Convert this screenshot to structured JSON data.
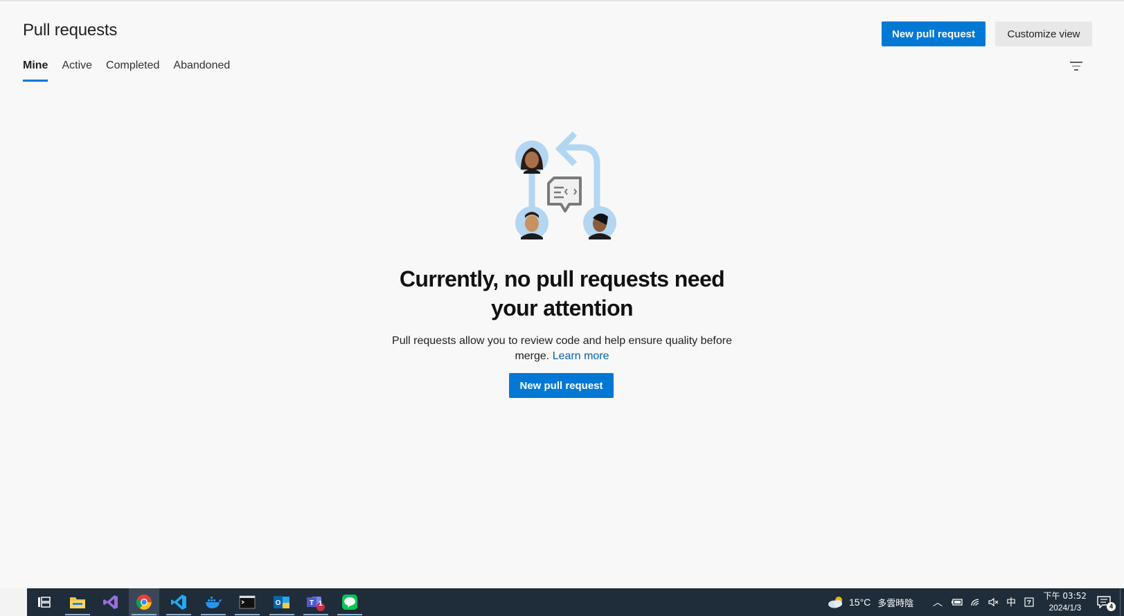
{
  "header": {
    "title": "Pull requests",
    "new_pull_request_label": "New pull request",
    "customize_view_label": "Customize view"
  },
  "tabs": [
    {
      "label": "Mine",
      "active": true
    },
    {
      "label": "Active",
      "active": false
    },
    {
      "label": "Completed",
      "active": false
    },
    {
      "label": "Abandoned",
      "active": false
    }
  ],
  "filter": {
    "icon": "filter-icon"
  },
  "empty_state": {
    "title": "Currently, no pull requests need your attention",
    "description": "Pull requests allow you to review code and help ensure quality before merge.",
    "learn_more_label": "Learn more",
    "button_label": "New pull request",
    "illustration": "pull-request-review-illustration"
  },
  "taskbar": {
    "apps": [
      "task-view-icon",
      "file-explorer-icon",
      "visual-studio-icon",
      "chrome-icon",
      "vscode-icon",
      "docker-icon",
      "terminal-icon",
      "outlook-icon",
      "teams-icon",
      "line-icon"
    ],
    "teams_badge": "1",
    "weather_temp": "15°C",
    "weather_text": "多雲時陰",
    "ime": "中",
    "clock_time": "下午 03:52",
    "clock_date": "2024/1/3",
    "notifications_count": "4"
  },
  "colors": {
    "accent": "#0078d4",
    "background": "#f8f8f8",
    "taskbar": "#1f2d3a",
    "link": "#0062b1"
  }
}
